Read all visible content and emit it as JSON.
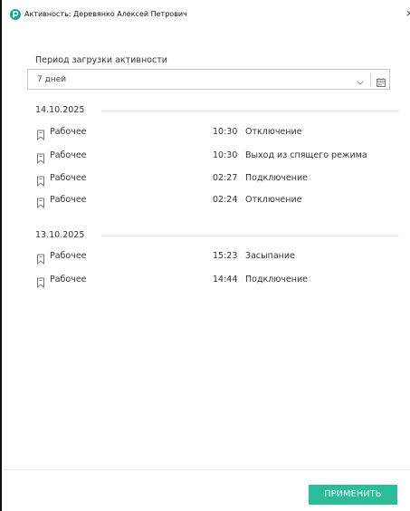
{
  "window": {
    "title": "Активность: Деревянко Алексей Петрович",
    "accent_color": "#2bbd9a"
  },
  "period": {
    "label": "Период загрузки активности",
    "selected": "7 дней",
    "icons": [
      "chevron-down-icon",
      "calendar-icon"
    ]
  },
  "groups": [
    {
      "date": "14.10.2025",
      "rows": [
        {
          "icon": "bookmark-icon",
          "label": "Рабочее",
          "time": "10:30",
          "event": "Отключение"
        },
        {
          "icon": "bookmark-icon",
          "label": "Рабочее",
          "time": "10:30",
          "event": "Выход из спящего режима"
        },
        {
          "icon": "bookmark-icon",
          "label": "Рабочее",
          "time": "02:27",
          "event": "Подключение"
        },
        {
          "icon": "bookmark-icon",
          "label": "Рабочее",
          "time": "02:24",
          "event": "Отключение"
        }
      ]
    },
    {
      "date": "13.10.2025",
      "rows": [
        {
          "icon": "bookmark-icon",
          "label": "Рабочее",
          "time": "15:23",
          "event": "Засыпание"
        },
        {
          "icon": "bookmark-icon",
          "label": "Рабочее",
          "time": "14:44",
          "event": "Подключение"
        }
      ]
    }
  ],
  "footer": {
    "apply_label": "ПРИМЕНИТЬ"
  }
}
